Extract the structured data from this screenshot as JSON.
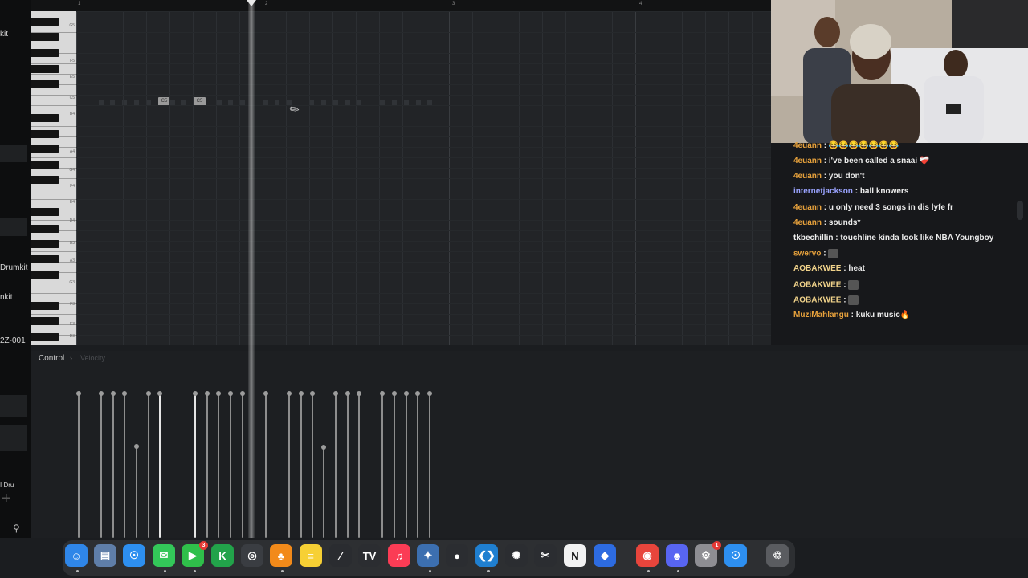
{
  "left_panel": {
    "items": [
      "kit",
      "Drumkit",
      "nkit",
      "2Z-001",
      "I Dru"
    ]
  },
  "timeline": {
    "bar_numbers": [
      "1",
      "2",
      "3",
      "4"
    ]
  },
  "piano": {
    "key_labels": [
      "G5",
      "F5",
      "E5",
      "C5",
      "B4",
      "A4",
      "G4",
      "F4",
      "E4",
      "D4",
      "B3",
      "A3",
      "G3",
      "F3",
      "E3",
      "D3"
    ]
  },
  "roll": {
    "notes": [
      {
        "label": "C5"
      },
      {
        "label": "C5"
      }
    ]
  },
  "control": {
    "label": "Control",
    "separator": "›",
    "parameter": "Velocity"
  },
  "chat": {
    "messages": [
      {
        "user": "4euann",
        "text": "😂😂😂😂😂😂😂",
        "color": "#e8a23c"
      },
      {
        "user": "4euann",
        "text": "i've been called a snaai ❤️‍🩹",
        "color": "#e8a23c"
      },
      {
        "user": "4euann",
        "text": "you don't",
        "color": "#e8a23c"
      },
      {
        "user": "internetjackson",
        "text": "ball knowers",
        "color": "#9aa3ff"
      },
      {
        "user": "4euann",
        "text": "u only need 3 songs in dis lyfe fr",
        "color": "#e8a23c"
      },
      {
        "user": "4euann",
        "text": "sounds*",
        "color": "#e8a23c"
      },
      {
        "user": "tkbechillin",
        "text": "touchline kinda look like NBA Youngboy",
        "color": "#f0f0f0"
      },
      {
        "user": "swervo",
        "text": "",
        "color": "#e8a23c"
      },
      {
        "user": "AOBAKWEE",
        "text": "heat",
        "color": "#f0d28a"
      },
      {
        "user": "AOBAKWEE",
        "text": "",
        "color": "#f0d28a"
      },
      {
        "user": "AOBAKWEE",
        "text": "",
        "color": "#f0d28a"
      },
      {
        "user": "MuziMahlangu",
        "text": "kuku music🔥",
        "color": "#e8a23c"
      }
    ]
  },
  "dock": {
    "apps": [
      {
        "name": "Finder",
        "icon": "finder-icon",
        "color": "#2f86e8"
      },
      {
        "name": "Files",
        "icon": "files-icon",
        "color": "#5f7ea8"
      },
      {
        "name": "Safari",
        "icon": "safari-icon",
        "color": "#2d8ff0"
      },
      {
        "name": "Messages",
        "icon": "messages-icon",
        "color": "#33c759"
      },
      {
        "name": "FaceTime",
        "icon": "facetime-icon",
        "color": "#2fbf4a",
        "badge": "3"
      },
      {
        "name": "Kontakt",
        "icon": "kontakt-icon",
        "color": "#22a34a"
      },
      {
        "name": "OBS",
        "icon": "obs-icon",
        "color": "#3a3d42"
      },
      {
        "name": "FL Studio",
        "icon": "fl-studio-icon",
        "color": "#f28a1a"
      },
      {
        "name": "Notes",
        "icon": "notes-icon",
        "color": "#f7d034"
      },
      {
        "name": "Pen",
        "icon": "pen-icon",
        "color": "#2a2c30"
      },
      {
        "name": "TradingView",
        "icon": "tradingview-icon",
        "color": "#2b2d31"
      },
      {
        "name": "Music",
        "icon": "music-icon",
        "color": "#fb3c55"
      },
      {
        "name": "DaVinci Resolve",
        "icon": "davinci-icon",
        "color": "#3c6fb0"
      },
      {
        "name": "GitHub",
        "icon": "github-icon",
        "color": "#2b2d31"
      },
      {
        "name": "VS Code",
        "icon": "vscode-icon",
        "color": "#1f7fd0"
      },
      {
        "name": "ChatGPT",
        "icon": "chatgpt-icon",
        "color": "#2b2d31"
      },
      {
        "name": "CapCut",
        "icon": "capcut-icon",
        "color": "#2b2d31"
      },
      {
        "name": "Notion",
        "icon": "notion-icon",
        "color": "#f2f2f2"
      },
      {
        "name": "Roblox",
        "icon": "roblox-icon",
        "color": "#2d6be0"
      },
      {
        "name": "Chrome",
        "icon": "chrome-icon",
        "color": "#e8453c"
      },
      {
        "name": "Discord",
        "icon": "discord-icon",
        "color": "#5865f2"
      },
      {
        "name": "System Settings",
        "icon": "settings-icon",
        "color": "#8e8e93",
        "badge": "1"
      },
      {
        "name": "Safari Technology Preview",
        "icon": "safari-preview-icon",
        "color": "#2d8ff0"
      },
      {
        "name": "Trash",
        "icon": "trash-icon",
        "color": "#5a5c60"
      }
    ]
  }
}
